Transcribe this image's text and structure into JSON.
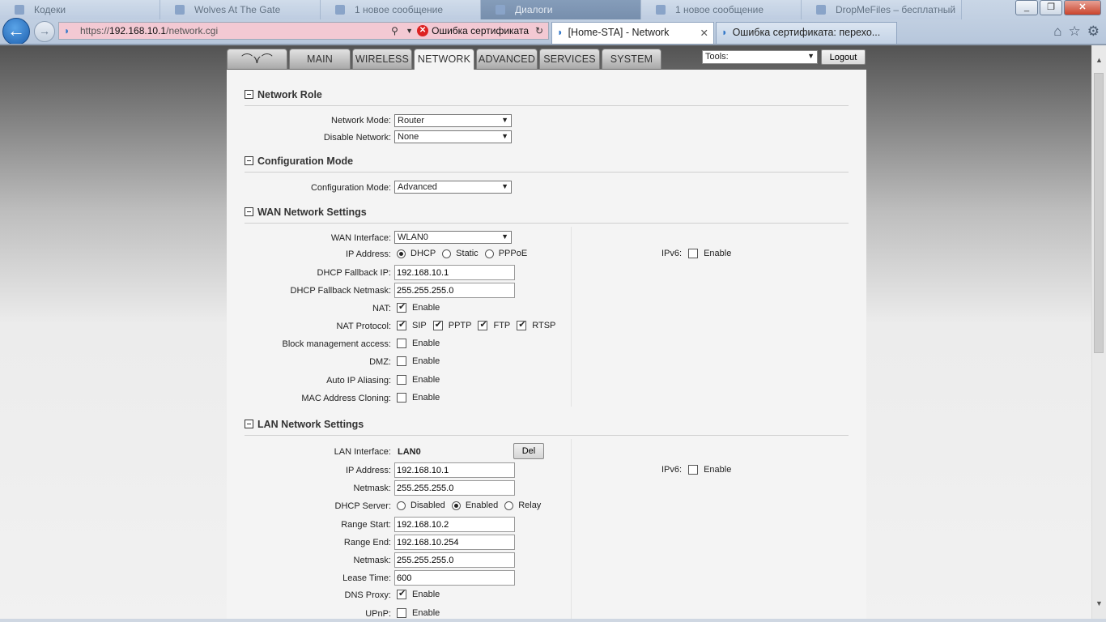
{
  "browser": {
    "os_tabs": [
      "Кодеки",
      "Wolves At The Gate",
      "1 новое сообщение",
      "Диалоги",
      "1 новое сообщение",
      "DropMeFiles – бесплатный"
    ],
    "url_prefix": "https://",
    "url_host": "192.168.10.1",
    "url_path": "/network.cgi",
    "cert_error": "Ошибка сертификата",
    "tabs": [
      {
        "title": "[Home-STA] - Network",
        "active": true
      },
      {
        "title": "Ошибка сертификата: перехо...",
        "active": false
      }
    ],
    "icons": {
      "back": "back-arrow-icon",
      "forward": "forward-arrow-icon",
      "home": "home-icon",
      "favorites": "star-icon",
      "settings": "gear-icon"
    }
  },
  "nav": {
    "tabs": [
      "MAIN",
      "WIRELESS",
      "NETWORK",
      "ADVANCED",
      "SERVICES",
      "SYSTEM"
    ],
    "active": "NETWORK",
    "tools_label": "Tools:",
    "logout": "Logout"
  },
  "network_role": {
    "title": "Network Role",
    "network_mode_label": "Network Mode:",
    "network_mode": "Router",
    "disable_network_label": "Disable Network:",
    "disable_network": "None"
  },
  "configuration_mode": {
    "title": "Configuration Mode",
    "label": "Configuration Mode:",
    "value": "Advanced"
  },
  "wan": {
    "title": "WAN Network Settings",
    "interface_label": "WAN Interface:",
    "interface": "WLAN0",
    "ip_label": "IP Address:",
    "ip_options": [
      "DHCP",
      "Static",
      "PPPoE"
    ],
    "ip_selected": "DHCP",
    "ipv6_label": "IPv6:",
    "ipv6_option": "Enable",
    "fallback_ip_label": "DHCP Fallback IP:",
    "fallback_ip": "192.168.10.1",
    "fallback_netmask_label": "DHCP Fallback Netmask:",
    "fallback_netmask": "255.255.255.0",
    "nat_label": "NAT:",
    "nat_option": "Enable",
    "nat_protocol_label": "NAT Protocol:",
    "nat_protocols": [
      "SIP",
      "PPTP",
      "FTP",
      "RTSP"
    ],
    "block_mgmt_label": "Block management access:",
    "dmz_label": "DMZ:",
    "auto_ip_label": "Auto IP Aliasing:",
    "mac_clone_label": "MAC Address Cloning:",
    "enable_text": "Enable"
  },
  "lan": {
    "title": "LAN Network Settings",
    "interface_label": "LAN Interface:",
    "interface": "LAN0",
    "del_button": "Del",
    "ip_label": "IP Address:",
    "ip": "192.168.10.1",
    "ipv6_label": "IPv6:",
    "ipv6_option": "Enable",
    "netmask_label": "Netmask:",
    "netmask": "255.255.255.0",
    "dhcp_label": "DHCP Server:",
    "dhcp_options": [
      "Disabled",
      "Enabled",
      "Relay"
    ],
    "dhcp_selected": "Enabled",
    "range_start_label": "Range Start:",
    "range_start": "192.168.10.2",
    "range_end_label": "Range End:",
    "range_end": "192.168.10.254",
    "dhcp_netmask_label": "Netmask:",
    "dhcp_netmask": "255.255.255.0",
    "lease_label": "Lease Time:",
    "lease": "600",
    "dns_proxy_label": "DNS Proxy:",
    "upnp_label": "UPnP:",
    "enable_text": "Enable"
  }
}
